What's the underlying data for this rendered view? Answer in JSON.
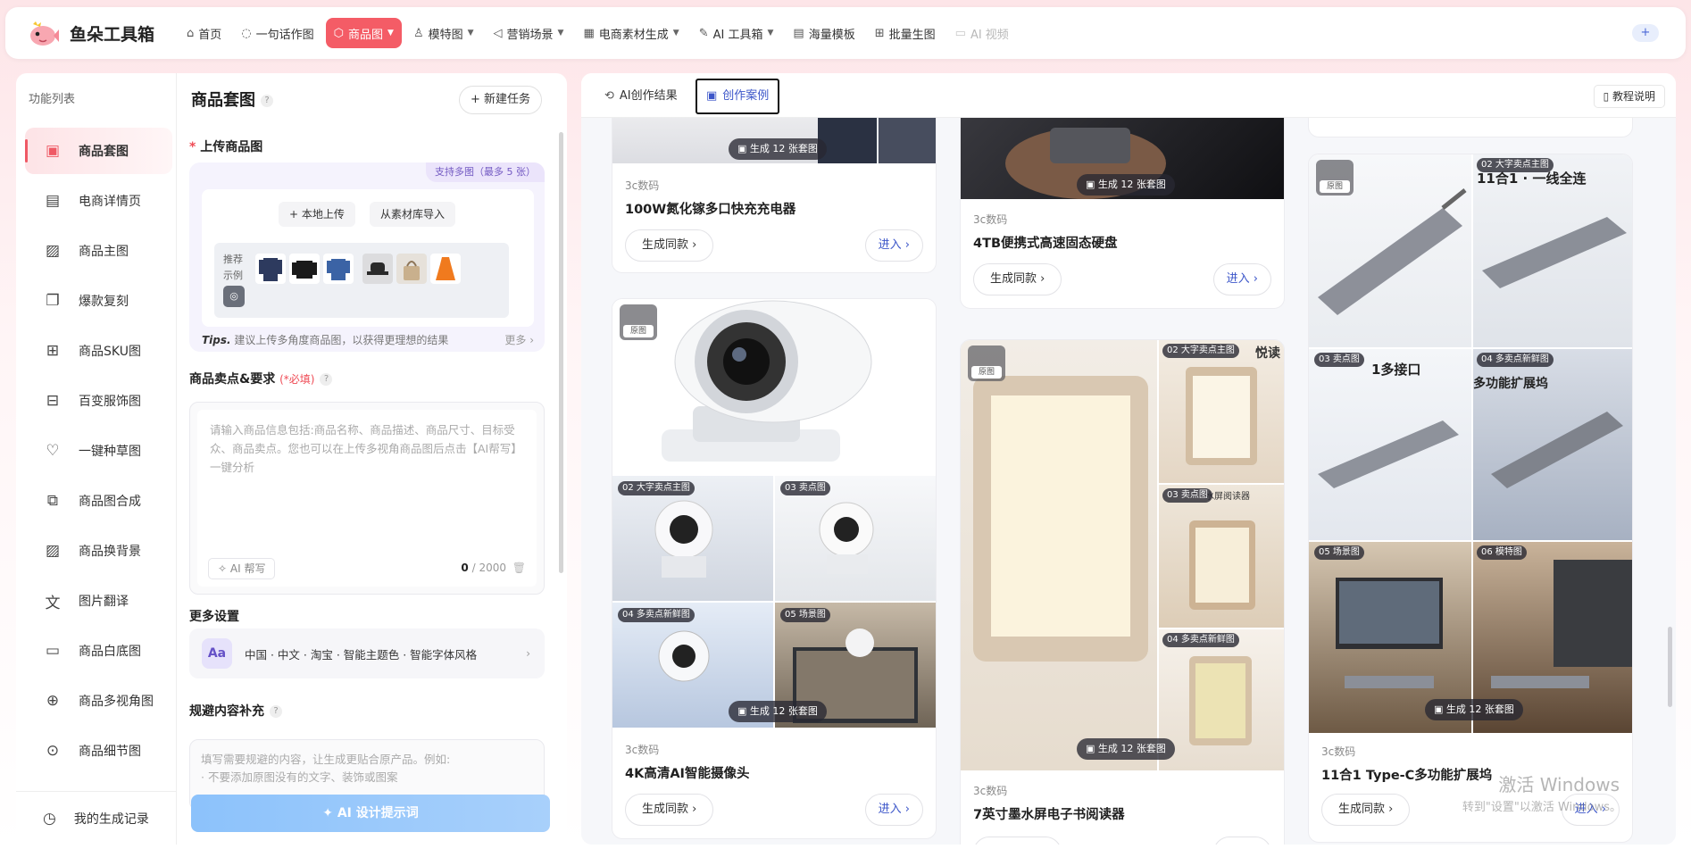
{
  "app": {
    "title": "鱼朵工具箱"
  },
  "nav": [
    {
      "label": "首页",
      "icon": "home-icon",
      "has_menu": false,
      "state": "normal"
    },
    {
      "label": "一句话作图",
      "icon": "chat-icon",
      "has_menu": false,
      "state": "normal"
    },
    {
      "label": "商品图",
      "icon": "box-icon",
      "has_menu": true,
      "state": "active"
    },
    {
      "label": "模特图",
      "icon": "person-icon",
      "has_menu": true,
      "state": "normal"
    },
    {
      "label": "营销场景",
      "icon": "megaphone-icon",
      "has_menu": true,
      "state": "normal"
    },
    {
      "label": "电商素材生成",
      "icon": "grid-icon",
      "has_menu": true,
      "state": "normal"
    },
    {
      "label": "AI 工具箱",
      "icon": "pen-icon",
      "has_menu": true,
      "state": "normal"
    },
    {
      "label": "海量模板",
      "icon": "template-icon",
      "has_menu": false,
      "state": "normal"
    },
    {
      "label": "批量生图",
      "icon": "batch-icon",
      "has_menu": false,
      "state": "normal"
    },
    {
      "label": "AI 视频",
      "icon": "video-icon",
      "has_menu": false,
      "state": "disabled"
    }
  ],
  "plus_label": "+",
  "sidebar": {
    "title": "功能列表",
    "items": [
      {
        "label": "商品套图",
        "icon": "image-set-icon"
      },
      {
        "label": "电商详情页",
        "icon": "document-icon"
      },
      {
        "label": "商品主图",
        "icon": "picture-icon"
      },
      {
        "label": "爆款复刻",
        "icon": "copy-icon"
      },
      {
        "label": "商品SKU图",
        "icon": "sku-grid-icon"
      },
      {
        "label": "百变服饰图",
        "icon": "apps-icon"
      },
      {
        "label": "一键种草图",
        "icon": "heart-icon"
      },
      {
        "label": "商品图合成",
        "icon": "compose-icon"
      },
      {
        "label": "商品换背景",
        "icon": "landscape-icon"
      },
      {
        "label": "图片翻译",
        "icon": "translate-icon"
      },
      {
        "label": "商品白底图",
        "icon": "white-bg-icon"
      },
      {
        "label": "商品多视角图",
        "icon": "globe-icon"
      },
      {
        "label": "商品细节图",
        "icon": "zoom-icon"
      }
    ],
    "history": "我的生成记录"
  },
  "form": {
    "title": "商品套图",
    "new_task": "+ 新建任务",
    "upload_label": "上传商品图",
    "upload_tag": "支持多图（最多 5 张）",
    "local_upload": "+ 本地上传",
    "library_import": "从素材库导入",
    "rec_label": "推荐示例",
    "tips_prefix": "Tips.",
    "tips": "建议上传多角度商品图，以获得更理想的结果",
    "more": "更多 ›",
    "selling_label": "商品卖点&要求",
    "required": "(*必填)",
    "selling_placeholder": "请输入商品信息包括:商品名称、商品描述、商品尺寸、目标受众、商品卖点。您也可以在上传多视角商品图后点击【AI帮写】一键分析",
    "ai_help": "AI 帮写",
    "count": "0",
    "max": "/ 2000",
    "more_settings": "更多设置",
    "settings_value": "中国 · 中文 · 淘宝 · 智能主题色 · 智能字体风格",
    "avoid_label": "规避内容补充",
    "avoid_placeholder": "填写需要规避的内容，让生成更贴合原产品。例如:\n· 不要添加原图没有的文字、装饰或图案",
    "generate": "✦ AI 设计提示词"
  },
  "tabs": {
    "results": "AI创作结果",
    "cases": "创作案例",
    "tutorial": "教程说明"
  },
  "cards": [
    {
      "category": "3c数码",
      "title": "100W氮化镓多口快充充电器",
      "badge": "生成 12 张套图"
    },
    {
      "category": "3c数码",
      "title": "4K高清AI智能摄像头",
      "badge": "生成 12 张套图",
      "tags": [
        "02 大字卖点主图",
        "03 卖点图",
        "04 多卖点新鲜图",
        "05 场景图"
      ]
    },
    {
      "category": "3c数码",
      "title": "4TB便携式高速固态硬盘",
      "badge": "生成 12 张套图"
    },
    {
      "category": "3c数码",
      "title": "7英寸墨水屏电子书阅读器",
      "badge": "生成 12 张套图",
      "tags": [
        "02 大字卖点主图",
        "03 卖点图",
        "04 多卖点新鲜图"
      ]
    },
    {
      "category": "3c数码",
      "title": "11合1 Type-C多功能扩展坞",
      "badge": "生成 12 张套图",
      "tags": [
        "02 大字卖点主图",
        "03 卖点图",
        "04 多卖点新鲜图",
        "05 场景图",
        "06 模特图"
      ]
    }
  ],
  "card_buttons": {
    "same": "生成同款 ›",
    "enter": "进入 ›"
  },
  "original_tag": "原图",
  "overlay_text": {
    "hub_headline": "11合1 · 一线全连",
    "hub_port": "1多接口",
    "hub_expand": "多功能扩展坞",
    "reader_headline": "悦读",
    "reader_sub": "水屏阅读器"
  },
  "watermark": {
    "line1": "激活 Windows",
    "line2": "转到\"设置\"以激活 Windows。"
  }
}
